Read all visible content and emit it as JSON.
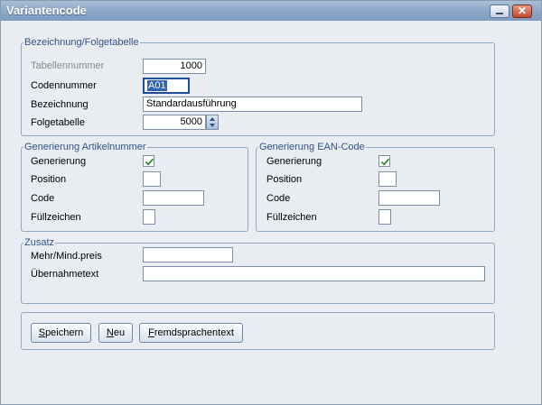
{
  "window": {
    "title": "Variantencode"
  },
  "bezeichnung_group": {
    "legend": "Bezeichnung/Folgetabelle",
    "tabellennummer_label": "Tabellennummer",
    "tabellennummer_value": "1000",
    "codennummer_label": "Codennummer",
    "codennummer_value": "A01",
    "bezeichnung_label": "Bezeichnung",
    "bezeichnung_value": "Standardausführung",
    "folgetabelle_label": "Folgetabelle",
    "folgetabelle_value": "5000"
  },
  "artikelnummer_group": {
    "legend": "Generierung Artikelnummer",
    "generierung_label": "Generierung",
    "generierung_checked": true,
    "position_label": "Position",
    "position_value": "",
    "code_label": "Code",
    "code_value": "",
    "fuellzeichen_label": "Füllzeichen",
    "fuellzeichen_value": ""
  },
  "ean_group": {
    "legend": "Generierung EAN-Code",
    "generierung_label": "Generierung",
    "generierung_checked": true,
    "position_label": "Position",
    "position_value": "",
    "code_label": "Code",
    "code_value": "",
    "fuellzeichen_label": "Füllzeichen",
    "fuellzeichen_value": ""
  },
  "zusatz_group": {
    "legend": "Zusatz",
    "mehrpreis_label": "Mehr/Mind.preis",
    "mehrpreis_value": "",
    "uebernahmetext_label": "Übernahmetext",
    "uebernahmetext_value": ""
  },
  "buttons": {
    "speichern_first": "S",
    "speichern_rest": "peichern",
    "neu_first": "N",
    "neu_rest": "eu",
    "fremd_first": "F",
    "fremd_rest": "remdsprachentext"
  },
  "icons": {
    "minimize": "minimize-icon",
    "close": "close-icon",
    "check": "checkmark-icon",
    "spin": "spin-arrows-icon"
  },
  "colors": {
    "accent": "#34508a",
    "titlebar": "#8ea9c9",
    "close": "#c24a2c",
    "check": "#2e8b2e"
  }
}
